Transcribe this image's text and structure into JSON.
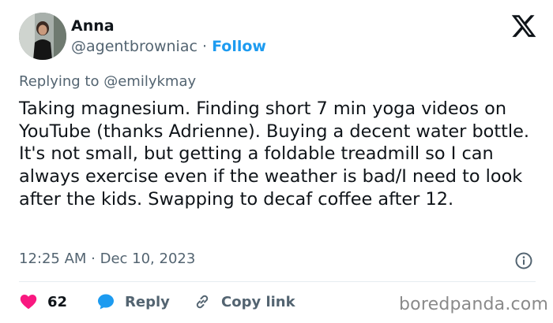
{
  "author": {
    "name": "Anna",
    "handle": "@agentbrowniac",
    "separator": "·",
    "follow_label": "Follow"
  },
  "reply_context": {
    "prefix": "Replying to",
    "mention": "@emilykmay"
  },
  "tweet": {
    "text": "Taking magnesium. Finding short 7 min yoga videos on YouTube (thanks Adrienne). Buying a decent water bottle. It's not small, but getting a foldable treadmill so I can always exercise even if the weather is bad/I need to look after the kids. Swapping to decaf coffee after 12.",
    "timestamp": "12:25 AM · Dec 10, 2023"
  },
  "actions": {
    "like_count": "62",
    "reply_label": "Reply",
    "copy_link_label": "Copy link"
  },
  "icons": {
    "platform": "x-logo-icon",
    "info": "info-icon",
    "like": "heart-icon",
    "reply": "speech-bubble-icon",
    "copy": "link-icon"
  },
  "colors": {
    "accent": "#1d9bf0",
    "like": "#f91880",
    "muted": "#536471"
  },
  "watermark": "boredpanda.com"
}
